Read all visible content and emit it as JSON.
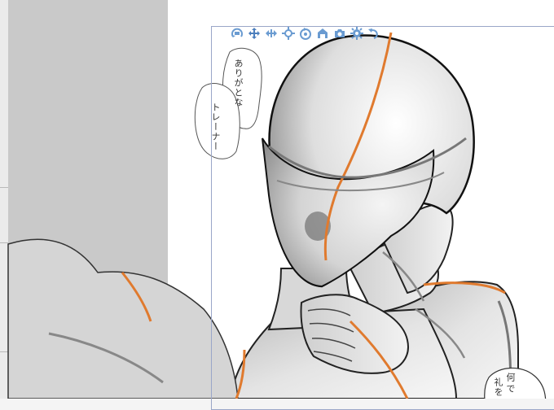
{
  "canvas": {
    "toolbar": {
      "tools": [
        {
          "name": "camera-rotate",
          "icon": "camera-rotate-icon"
        },
        {
          "name": "camera-move",
          "icon": "move-arrows-icon"
        },
        {
          "name": "camera-zoom",
          "icon": "zoom-arrows-icon"
        },
        {
          "name": "object-move",
          "icon": "crosshair-move-icon"
        },
        {
          "name": "object-rotate",
          "icon": "rotate-object-icon"
        },
        {
          "name": "ground",
          "icon": "ground-icon"
        },
        {
          "name": "camera-mode",
          "icon": "camera-icon"
        },
        {
          "name": "settings",
          "icon": "gear-icon"
        },
        {
          "name": "reset",
          "icon": "undo-curl-icon"
        }
      ],
      "accent": "#6a9bd1"
    },
    "balloons": [
      {
        "text": "ありがとな"
      },
      {
        "text": "トレーナー"
      },
      {
        "text": "何"
      },
      {
        "text": "礼"
      },
      {
        "text": "を"
      },
      {
        "text": "で"
      }
    ]
  }
}
